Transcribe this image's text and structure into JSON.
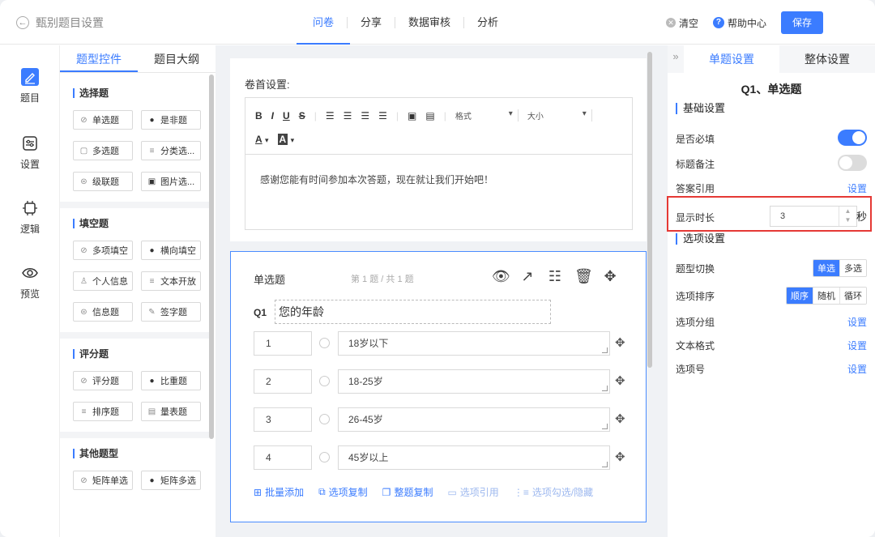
{
  "header": {
    "back_title": "甄别题目设置",
    "tabs": [
      {
        "label": "问卷",
        "active": true
      },
      {
        "label": "分享",
        "active": false
      },
      {
        "label": "数据审核",
        "active": false
      },
      {
        "label": "分析",
        "active": false
      }
    ],
    "clear_label": "清空",
    "help_label": "帮助中心",
    "save_label": "保存"
  },
  "leftnav": {
    "items": [
      {
        "label": "题目",
        "icon": "edit-icon",
        "active": true
      },
      {
        "label": "设置",
        "icon": "settings-icon",
        "active": false
      },
      {
        "label": "逻辑",
        "icon": "logic-icon",
        "active": false
      },
      {
        "label": "预览",
        "icon": "eye-icon",
        "active": false
      }
    ]
  },
  "components": {
    "tabs": [
      {
        "label": "题型控件",
        "active": true
      },
      {
        "label": "题目大纲",
        "active": false
      }
    ],
    "groups": [
      {
        "title": "选择题",
        "items": [
          {
            "label": "单选题",
            "icon": "radio-icon"
          },
          {
            "label": "是非题",
            "icon": "yes-no-icon"
          },
          {
            "label": "多选题",
            "icon": "checkbox-icon"
          },
          {
            "label": "分类选...",
            "icon": "list-icon"
          },
          {
            "label": "级联题",
            "icon": "cascade-icon"
          },
          {
            "label": "图片选...",
            "icon": "image-icon"
          }
        ]
      },
      {
        "title": "填空题",
        "items": [
          {
            "label": "多项填空",
            "icon": "radio-icon"
          },
          {
            "label": "横向填空",
            "icon": "yes-no-icon"
          },
          {
            "label": "个人信息",
            "icon": "person-icon"
          },
          {
            "label": "文本开放",
            "icon": "list-icon"
          },
          {
            "label": "信息题",
            "icon": "cascade-icon"
          },
          {
            "label": "签字题",
            "icon": "pen-icon"
          }
        ]
      },
      {
        "title": "评分题",
        "items": [
          {
            "label": "评分题",
            "icon": "radio-icon"
          },
          {
            "label": "比重题",
            "icon": "yes-no-icon"
          },
          {
            "label": "排序题",
            "icon": "list-icon"
          },
          {
            "label": "量表题",
            "icon": "scale-icon"
          }
        ]
      },
      {
        "title": "其他题型",
        "items": [
          {
            "label": "矩阵单选",
            "icon": "radio-icon"
          },
          {
            "label": "矩阵多选",
            "icon": "yes-no-icon"
          }
        ]
      }
    ]
  },
  "header_card": {
    "label": "卷首设置:",
    "toolbar": {
      "bold": "B",
      "italic": "I",
      "underline": "U",
      "strike": "S",
      "format_label": "格式",
      "size_label": "大小",
      "font_color": "A",
      "bg_color": "A"
    },
    "content": "感谢您能有时间参加本次答题，现在就让我们开始吧！"
  },
  "question": {
    "type_label": "单选题",
    "page_info": "第 1 题 / 共 1 题",
    "number": "Q1",
    "title": "您的年龄",
    "options": [
      {
        "no": "1",
        "text": "18岁以下"
      },
      {
        "no": "2",
        "text": "18-25岁"
      },
      {
        "no": "3",
        "text": "26-45岁"
      },
      {
        "no": "4",
        "text": "45岁以上"
      }
    ],
    "actions": [
      {
        "label": "批量添加",
        "icon": "plus-square-icon",
        "disabled": false
      },
      {
        "label": "选项复制",
        "icon": "copy-icon",
        "disabled": false
      },
      {
        "label": "整题复制",
        "icon": "copy-question-icon",
        "disabled": false
      },
      {
        "label": "选项引用",
        "icon": "reference-icon",
        "disabled": true
      },
      {
        "label": "选项勾选/隐藏",
        "icon": "filter-icon",
        "disabled": true
      }
    ]
  },
  "right_panel": {
    "tabs": [
      {
        "label": "单题设置",
        "active": true
      },
      {
        "label": "整体设置",
        "active": false
      }
    ],
    "heading": "Q1、单选题",
    "basic_section": "基础设置",
    "required_label": "是否必填",
    "required_on": true,
    "note_label": "标题备注",
    "note_on": false,
    "answer_ref_label": "答案引用",
    "answer_ref_link": "设置",
    "duration_label": "显示时长",
    "duration_value": "3",
    "duration_unit": "秒",
    "option_section": "选项设置",
    "type_switch_label": "题型切换",
    "type_switch_options": [
      "单选",
      "多选"
    ],
    "type_switch_selected": "单选",
    "order_label": "选项排序",
    "order_options": [
      "顺序",
      "随机",
      "循环"
    ],
    "order_selected": "顺序",
    "group_label": "选项分组",
    "group_link": "设置",
    "text_format_label": "文本格式",
    "text_format_link": "设置",
    "option_no_label": "选项号",
    "option_no_link": "设置"
  },
  "colors": {
    "accent": "#3b7cff",
    "highlight_border": "#e53935"
  }
}
